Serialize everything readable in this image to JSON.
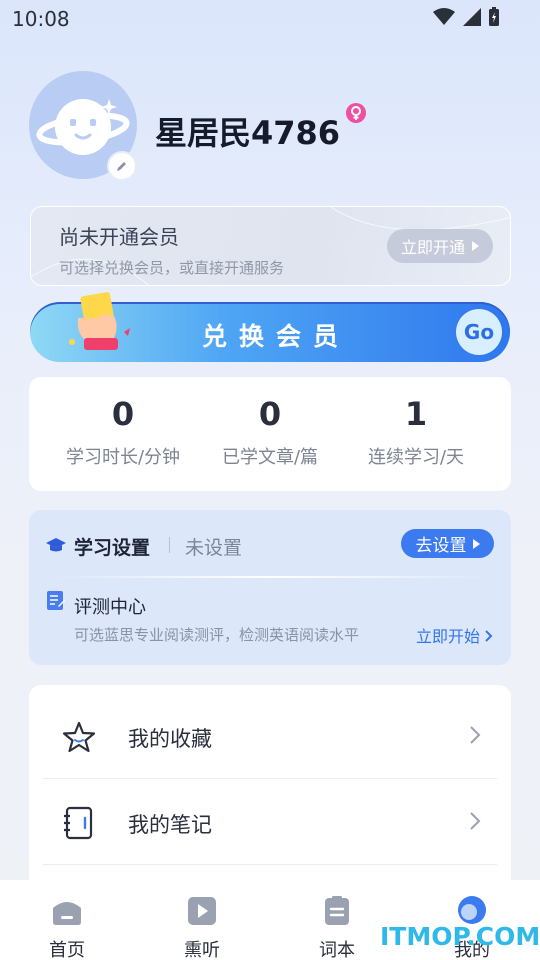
{
  "status_bar": {
    "time": "10:08"
  },
  "profile": {
    "username": "星居民4786"
  },
  "vip_card": {
    "title": "尚未开通会员",
    "subtitle": "可选择兑换会员，或直接开通服务",
    "button_label": "立即开通"
  },
  "exchange_banner": {
    "label": "兑换会员",
    "go_label": "Go"
  },
  "stats": [
    {
      "value": "0",
      "label": "学习时长/分钟"
    },
    {
      "value": "0",
      "label": "已学文章/篇"
    },
    {
      "value": "1",
      "label": "连续学习/天"
    }
  ],
  "study_settings": {
    "title": "学习设置",
    "value": "未设置",
    "button_label": "去设置",
    "eval_title": "评测中心",
    "eval_subtitle": "可选蓝思专业阅读测评，检测英语阅读水平",
    "eval_link": "立即开始"
  },
  "menu": {
    "items": [
      {
        "label": "我的收藏",
        "icon": "star-icon"
      },
      {
        "label": "我的笔记",
        "icon": "notebook-icon"
      }
    ]
  },
  "tabbar": {
    "tabs": [
      {
        "label": "首页",
        "icon": "home-icon"
      },
      {
        "label": "熏听",
        "icon": "play-icon"
      },
      {
        "label": "词本",
        "icon": "wordbook-icon"
      },
      {
        "label": "我的",
        "icon": "profile-icon"
      }
    ]
  },
  "watermark": "ITMOP.COM",
  "colors": {
    "accent": "#3c7af0",
    "avatar_bg": "#b9ccf3",
    "gender": "#ef4fa0"
  }
}
